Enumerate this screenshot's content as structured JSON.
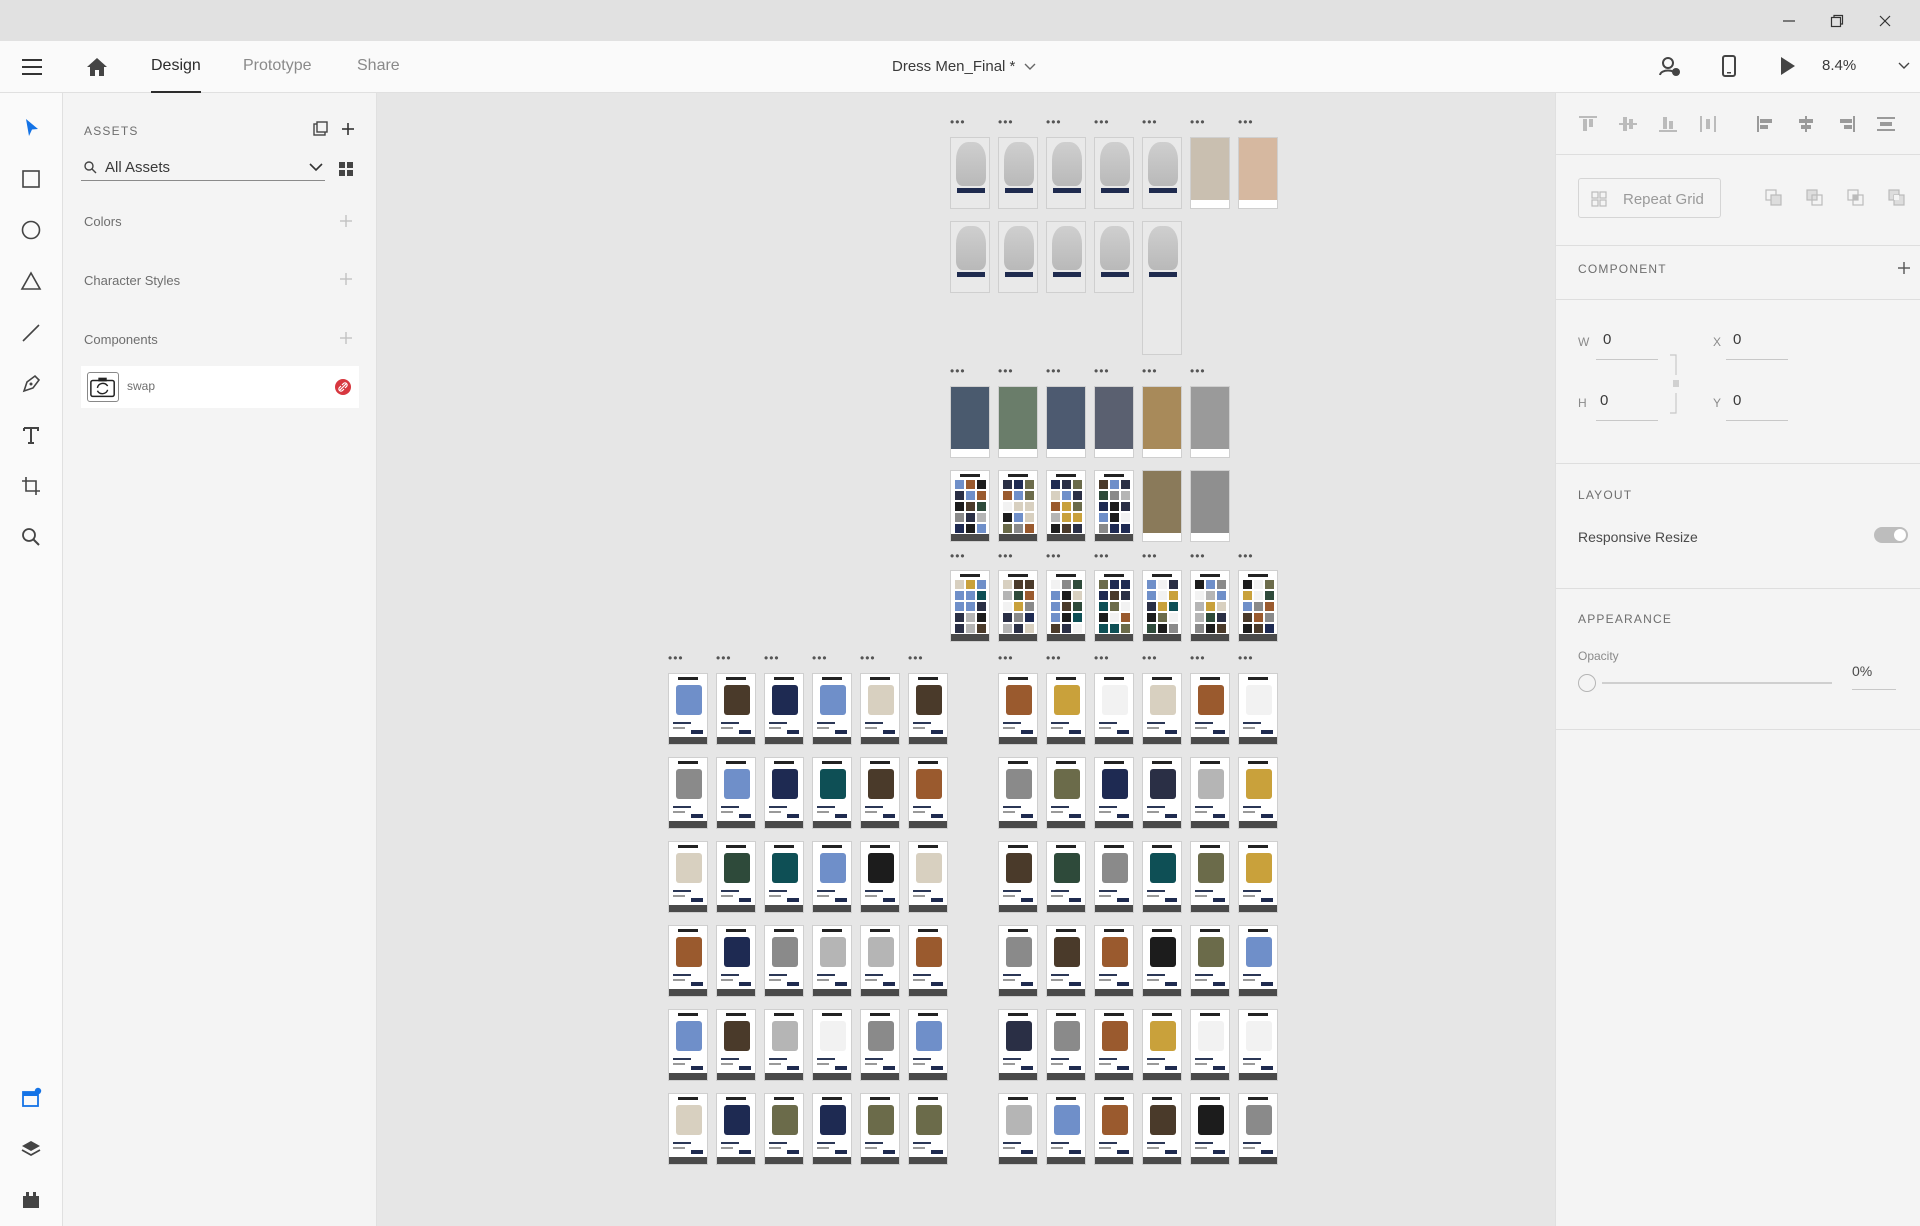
{
  "window": {
    "controls": [
      "minimize-icon",
      "restore-icon",
      "close-icon"
    ]
  },
  "topbar": {
    "tabs": [
      {
        "label": "Design",
        "active": true
      },
      {
        "label": "Prototype",
        "active": false
      },
      {
        "label": "Share",
        "active": false
      }
    ],
    "document_title": "Dress Men_Final *",
    "zoom": "8.4%"
  },
  "assets": {
    "title": "ASSETS",
    "filter": "All Assets",
    "sections": [
      "Colors",
      "Character Styles",
      "Components"
    ],
    "component": {
      "name": "swap"
    }
  },
  "props": {
    "repeat_grid": "Repeat Grid",
    "component_title": "COMPONENT",
    "w_label": "W",
    "w": "0",
    "h_label": "H",
    "h": "0",
    "x_label": "X",
    "x": "0",
    "y_label": "Y",
    "y": "0",
    "layout_title": "LAYOUT",
    "responsive_resize": "Responsive Resize",
    "appearance_title": "APPEARANCE",
    "opacity_label": "Opacity",
    "opacity": "0%"
  },
  "colors": {
    "accent": "#1473e6",
    "badge": "#d7373f",
    "navy": "#1f2b4f"
  }
}
